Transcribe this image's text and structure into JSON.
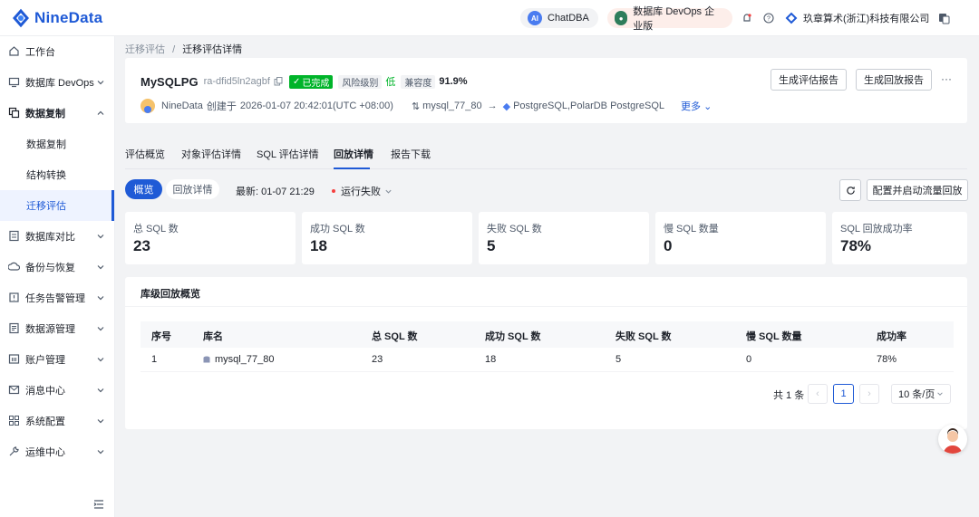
{
  "brand": {
    "name": "NineData",
    "accent": "#1f5ad6"
  },
  "topbar": {
    "chat_label": "ChatDBA",
    "chat_badge": "AI",
    "edition_label": "数据库 DevOps 企业版",
    "company": "玖章算术(浙江)科技有限公司",
    "icons": [
      "bell-icon",
      "help-icon",
      "company-logo-icon",
      "language-switch-icon"
    ]
  },
  "sidebar": {
    "items": [
      {
        "label": "工作台",
        "icon": "home-icon",
        "expandable": false
      },
      {
        "label": "数据库 DevOps",
        "icon": "monitor-icon",
        "expandable": true
      },
      {
        "label": "数据复制",
        "icon": "copy-icon",
        "expandable": true,
        "expanded": true
      },
      {
        "label": "数据复制",
        "sub": true
      },
      {
        "label": "结构转换",
        "sub": true
      },
      {
        "label": "迁移评估",
        "sub": true,
        "active": true
      },
      {
        "label": "数据库对比",
        "icon": "compare-icon",
        "expandable": true
      },
      {
        "label": "备份与恢复",
        "icon": "backup-icon",
        "expandable": true
      },
      {
        "label": "任务告警管理",
        "icon": "alert-icon",
        "expandable": true
      },
      {
        "label": "数据源管理",
        "icon": "datasource-icon",
        "expandable": true
      },
      {
        "label": "账户管理",
        "icon": "account-icon",
        "expandable": true
      },
      {
        "label": "消息中心",
        "icon": "message-icon",
        "expandable": true
      },
      {
        "label": "系统配置",
        "icon": "settings-icon",
        "expandable": true
      },
      {
        "label": "运维中心",
        "icon": "wrench-icon",
        "expandable": true
      }
    ]
  },
  "breadcrumb": {
    "parent": "迁移评估",
    "separator": "/",
    "current": "迁移评估详情"
  },
  "header": {
    "name": "MySQLPG",
    "id": "ra-dfid5ln2agbf",
    "status": "已完成",
    "risk_label": "风险级别",
    "risk_value": "低",
    "compat_label": "兼容度",
    "compat_value": "91.9%",
    "creator": "NineData",
    "created_text": "创建于",
    "created_at": "2026-01-07 20:42:01(UTC +08:00)",
    "source": "mysql_77_80",
    "target": "PostgreSQL,PolarDB PostgreSQL",
    "more": "更多",
    "btn_report": "生成评估报告",
    "btn_replay_report": "生成回放报告",
    "menu": "···"
  },
  "tabs": [
    {
      "label": "评估概览"
    },
    {
      "label": "对象评估详情"
    },
    {
      "label": "SQL 评估详情"
    },
    {
      "label": "回放详情",
      "active": true
    },
    {
      "label": "报告下载"
    }
  ],
  "replay": {
    "seg_overview": "概览",
    "seg_detail": "回放详情",
    "latest_label": "最新:",
    "latest_time": "01-07 21:29",
    "run_status": "运行失败",
    "btn_configure": "配置并启动流量回放"
  },
  "stats": [
    {
      "label": "总 SQL 数",
      "value": "23"
    },
    {
      "label": "成功 SQL 数",
      "value": "18"
    },
    {
      "label": "失败 SQL 数",
      "value": "5"
    },
    {
      "label": "慢 SQL 数量",
      "value": "0"
    },
    {
      "label": "SQL 回放成功率",
      "value": "78%"
    }
  ],
  "db_overview": {
    "title": "库级回放概览",
    "columns": [
      "序号",
      "库名",
      "总 SQL 数",
      "成功 SQL 数",
      "失败 SQL 数",
      "慢 SQL 数量",
      "成功率"
    ],
    "rows": [
      [
        "1",
        "mysql_77_80",
        "23",
        "18",
        "5",
        "0",
        "78%"
      ]
    ]
  },
  "pagination": {
    "total": "共 1 条",
    "page": "1",
    "page_size": "10 条/页"
  },
  "colors": {
    "primary": "#1f5ad6",
    "success": "#00b42a",
    "danger": "#f53f3f",
    "bg": "#f2f3f5"
  }
}
